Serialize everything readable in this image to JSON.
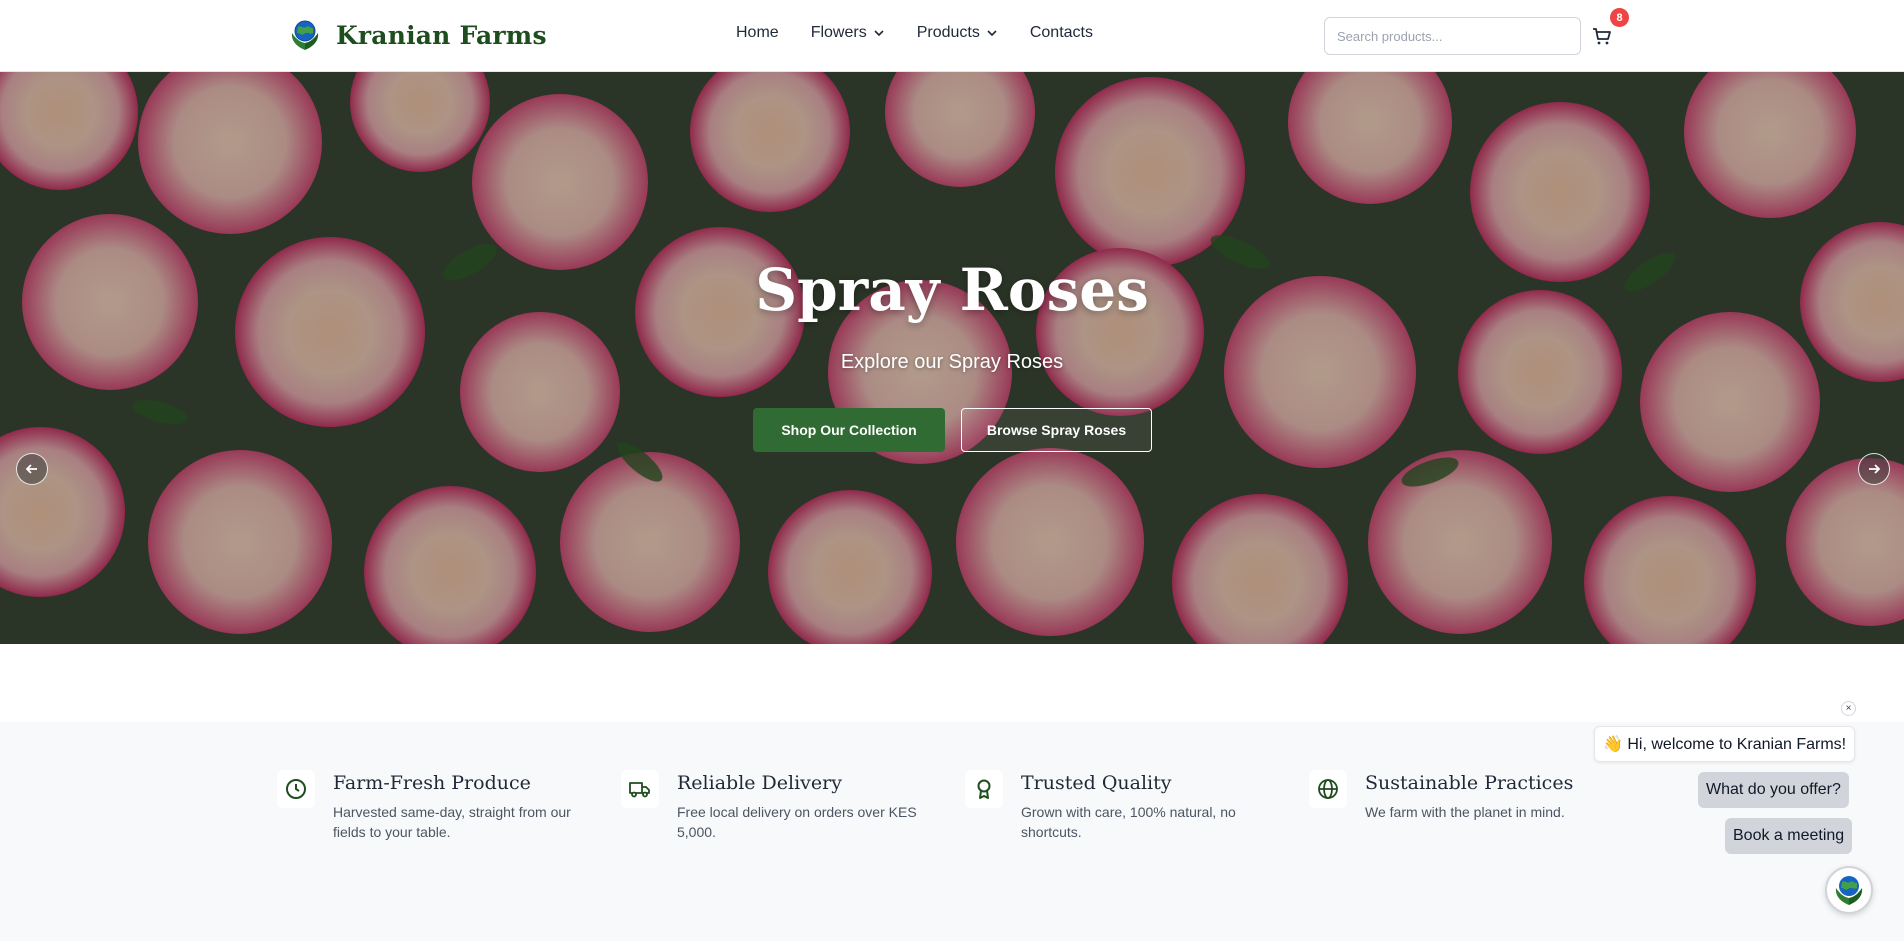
{
  "brand": {
    "name": "Kranian Farms",
    "accent": "#2f6b32",
    "logo_icon": "globe-leaf-logo"
  },
  "nav": {
    "items": [
      {
        "label": "Home",
        "has_dropdown": false
      },
      {
        "label": "Flowers",
        "has_dropdown": true
      },
      {
        "label": "Products",
        "has_dropdown": true
      },
      {
        "label": "Contacts",
        "has_dropdown": false
      }
    ]
  },
  "search": {
    "placeholder": "Search products...",
    "value": ""
  },
  "cart": {
    "icon": "cart-icon",
    "count": "8"
  },
  "hero": {
    "title": "Spray Roses",
    "subtitle": "Explore our Spray Roses",
    "primary_button": "Shop Our Collection",
    "secondary_button": "Browse Spray Roses"
  },
  "features": [
    {
      "icon": "clock-icon",
      "title": "Farm-Fresh Produce",
      "description": "Harvested same-day, straight from our fields to your table."
    },
    {
      "icon": "truck-icon",
      "title": "Reliable Delivery",
      "description": "Free local delivery on orders over KES 5,000."
    },
    {
      "icon": "award-icon",
      "title": "Trusted Quality",
      "description": "Grown with care, 100% natural, no shortcuts."
    },
    {
      "icon": "globe-icon",
      "title": "Sustainable Practices",
      "description": "We farm with the planet in mind."
    }
  ],
  "chat": {
    "greeting": "👋 Hi, welcome to Kranian Farms!",
    "options": [
      "What do you offer?",
      "Book a meeting"
    ],
    "close": "×"
  }
}
